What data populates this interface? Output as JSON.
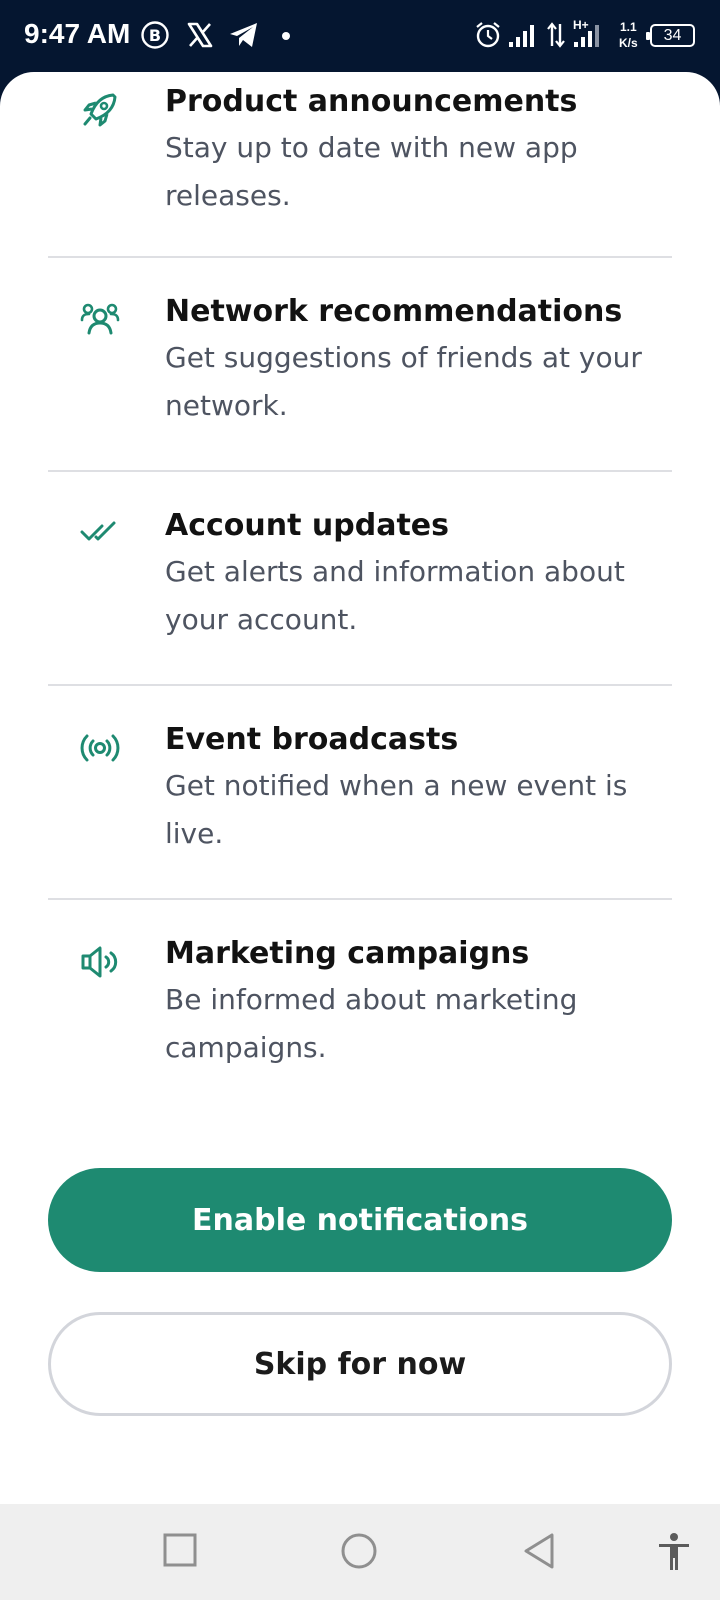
{
  "status_bar": {
    "time": "9:47 AM",
    "network_speed_value": "1.1",
    "network_speed_unit": "K/s",
    "network_type": "H+",
    "battery": "34",
    "icons": [
      "b-circle-icon",
      "x-logo-icon",
      "telegram-icon",
      "dot-icon",
      "alarm-icon",
      "signal-icon",
      "data-arrows-icon",
      "signal-icon",
      "battery-icon"
    ]
  },
  "notifications": {
    "items": [
      {
        "icon": "rocket-icon",
        "title": "Product announcements",
        "description": "Stay up to date with new app releases."
      },
      {
        "icon": "people-icon",
        "title": "Network recommendations",
        "description": "Get suggestions of friends at your network."
      },
      {
        "icon": "double-check-icon",
        "title": "Account updates",
        "description": "Get alerts and information about your account."
      },
      {
        "icon": "broadcast-icon",
        "title": "Event broadcasts",
        "description": "Get notified when a new event is live."
      },
      {
        "icon": "megaphone-icon",
        "title": "Marketing campaigns",
        "description": "Be informed about marketing campaigns."
      }
    ],
    "enable_label": "Enable notifications",
    "skip_label": "Skip for now"
  },
  "colors": {
    "accent": "#1e8a71",
    "status_bar_bg": "#051630",
    "title_text": "#121212",
    "description_text": "#4e5461"
  },
  "nav_bar": {
    "buttons": [
      "recents-square-icon",
      "home-circle-icon",
      "back-triangle-icon",
      "accessibility-icon"
    ]
  }
}
